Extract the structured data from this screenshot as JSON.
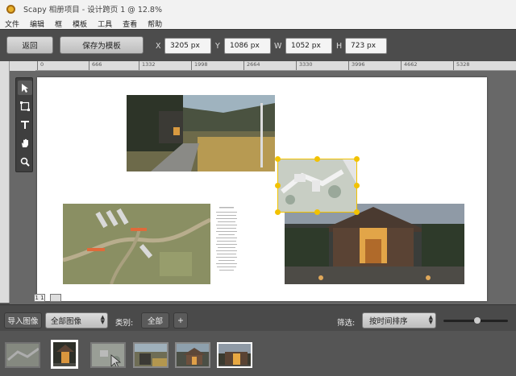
{
  "window": {
    "title": "Scapy 相册项目 - 设计跨页 1 @ 12.8%"
  },
  "menu": [
    "文件",
    "编辑",
    "框",
    "模板",
    "工具",
    "查看",
    "帮助"
  ],
  "toolbar": {
    "back_label": "返回",
    "save_template_label": "保存为模板",
    "x_label": "X",
    "x_value": "3205 px",
    "y_label": "Y",
    "y_value": "1086 px",
    "w_label": "W",
    "w_value": "1052 px",
    "h_label": "H",
    "h_value": "723 px"
  },
  "ruler": {
    "ticks": [
      "0",
      "666",
      "1332",
      "1998",
      "2664",
      "3330",
      "3996",
      "4662",
      "5328"
    ]
  },
  "tools": [
    "pointer-icon",
    "frame-icon",
    "text-icon",
    "hand-icon",
    "zoom-icon"
  ],
  "page_indicator": {
    "current": "1 1"
  },
  "bottom": {
    "import_label": "导入图像",
    "filter_select": "全部图像",
    "category_label": "类别:",
    "category_value": "全部",
    "add_label": "+",
    "sort_label": "筛选:",
    "sort_value": "按时间排序",
    "zoom_level": 0.52
  },
  "thumbnails": [
    "site-plan-aerial",
    "house-entrance-night",
    "selected-plan",
    "garden-terrace",
    "house-exterior",
    "house-lit-night"
  ],
  "colors": {
    "selection": "#f2c200",
    "toolbar_bg": "#4c4c4c"
  }
}
